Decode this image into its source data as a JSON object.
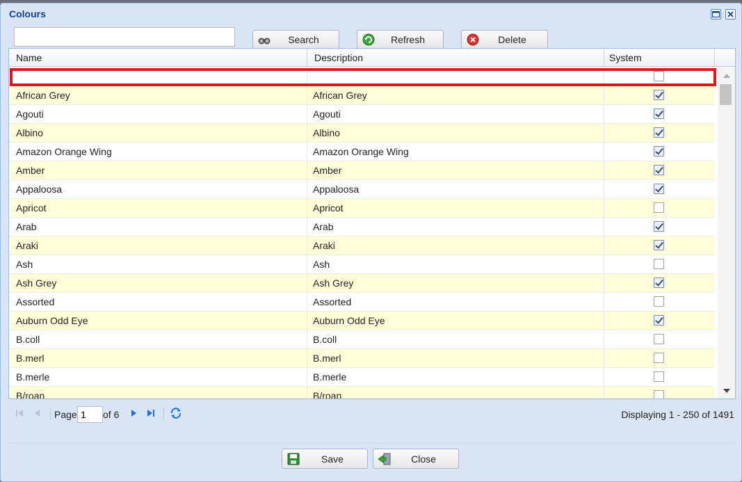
{
  "window": {
    "title": "Colours"
  },
  "toolbar": {
    "search_value": "",
    "search_label": "Search",
    "refresh_label": "Refresh",
    "delete_label": "Delete"
  },
  "grid": {
    "columns": [
      "Name",
      "Description",
      "System"
    ],
    "rows": [
      {
        "name": "",
        "description": "",
        "system": false
      },
      {
        "name": "African Grey",
        "description": "African Grey",
        "system": true
      },
      {
        "name": "Agouti",
        "description": "Agouti",
        "system": true
      },
      {
        "name": "Albino",
        "description": "Albino",
        "system": true
      },
      {
        "name": "Amazon Orange Wing",
        "description": "Amazon Orange Wing",
        "system": true
      },
      {
        "name": "Amber",
        "description": "Amber",
        "system": true
      },
      {
        "name": "Appaloosa",
        "description": "Appaloosa",
        "system": true
      },
      {
        "name": "Apricot",
        "description": "Apricot",
        "system": false
      },
      {
        "name": "Arab",
        "description": "Arab",
        "system": true
      },
      {
        "name": "Araki",
        "description": "Araki",
        "system": true
      },
      {
        "name": "Ash",
        "description": "Ash",
        "system": false
      },
      {
        "name": "Ash Grey",
        "description": "Ash Grey",
        "system": true
      },
      {
        "name": "Assorted",
        "description": "Assorted",
        "system": false
      },
      {
        "name": "Auburn Odd Eye",
        "description": "Auburn Odd Eye",
        "system": true
      },
      {
        "name": "B.coll",
        "description": "B.coll",
        "system": false
      },
      {
        "name": "B.merl",
        "description": "B.merl",
        "system": false
      },
      {
        "name": "B.merle",
        "description": "B.merle",
        "system": false
      },
      {
        "name": "B/roan",
        "description": "B/roan",
        "system": false
      }
    ]
  },
  "pager": {
    "page_label": "Page",
    "page_value": "1",
    "of_label": "of 6",
    "displaying": "Displaying 1 - 250 of 1491"
  },
  "footer": {
    "save_label": "Save",
    "close_label": "Close"
  },
  "colors": {
    "title_blue": "#15428b",
    "window_bg": "#d9e5f4",
    "alt_row": "#fffed9",
    "highlight_red": "#e3141c"
  }
}
